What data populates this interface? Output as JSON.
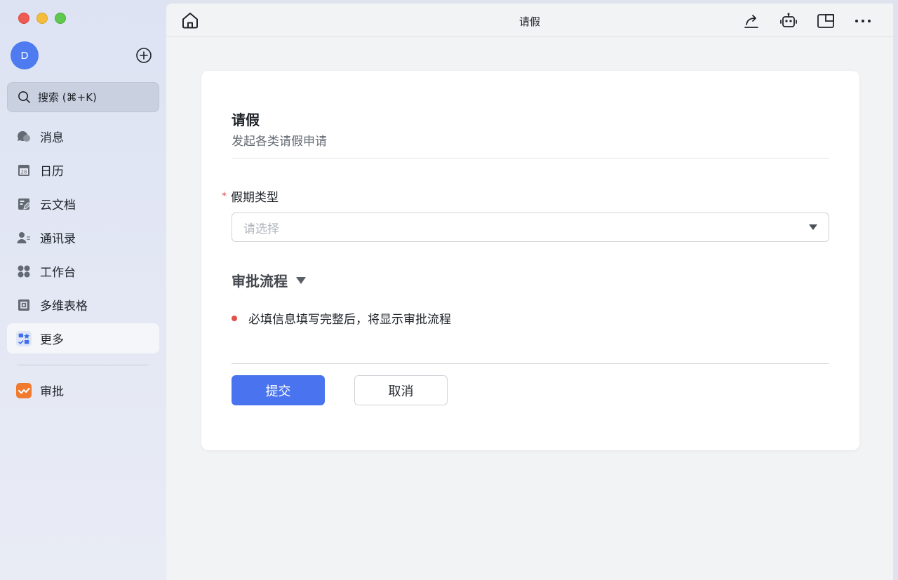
{
  "sidebar": {
    "avatar_initial": "D",
    "search_label": "搜索 (⌘+K)",
    "items": [
      {
        "label": "消息",
        "icon": "message-icon"
      },
      {
        "label": "日历",
        "icon": "calendar-icon"
      },
      {
        "label": "云文档",
        "icon": "docs-icon"
      },
      {
        "label": "通讯录",
        "icon": "contacts-icon"
      },
      {
        "label": "工作台",
        "icon": "workplace-icon"
      },
      {
        "label": "多维表格",
        "icon": "base-icon"
      },
      {
        "label": "更多",
        "icon": "more-apps-icon",
        "active": true
      }
    ],
    "calendar_day": "28",
    "pinned_app": {
      "label": "审批",
      "icon": "approval-icon",
      "color": "#f07a2e"
    }
  },
  "topbar": {
    "title": "请假"
  },
  "form": {
    "title": "请假",
    "subtitle": "发起各类请假申请",
    "required_mark": "*",
    "field_label": "假期类型",
    "select_placeholder": "请选择",
    "flow_title": "审批流程",
    "flow_note": "必填信息填写完整后，将显示审批流程",
    "submit_label": "提交",
    "cancel_label": "取消"
  },
  "colors": {
    "primary": "#4a74ef",
    "required": "#e25048",
    "avatar": "#4e7cf0"
  }
}
